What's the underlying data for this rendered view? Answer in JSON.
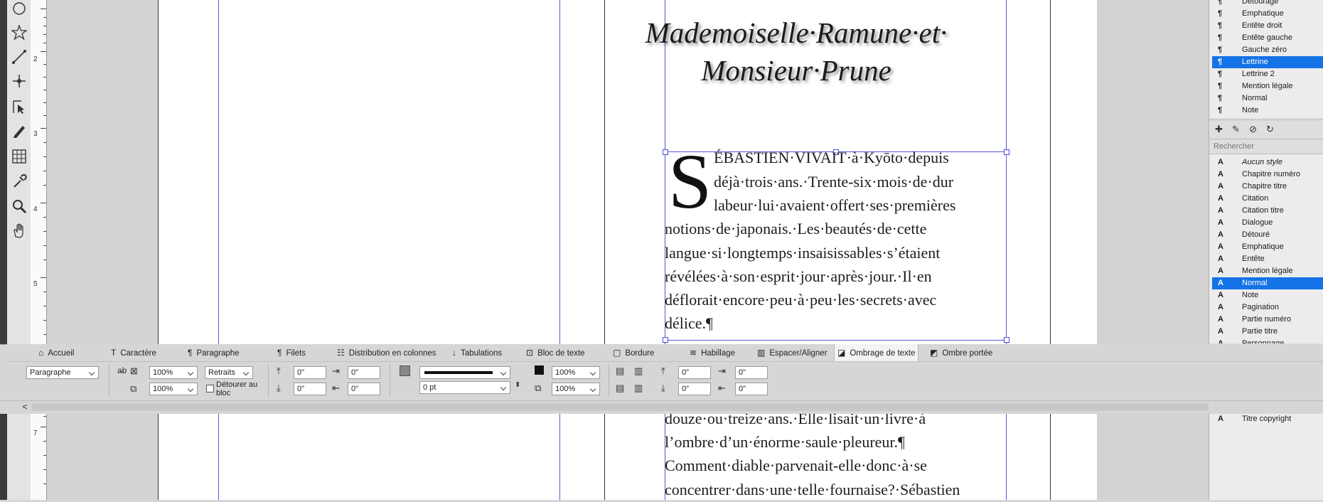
{
  "toolbox": {
    "tools": [
      "ellipse-tool-icon",
      "star-tool-icon",
      "line-tool-icon",
      "pen-anchor-tool-icon",
      "direct-selection-tool-icon",
      "pencil-tool-icon",
      "table-tool-icon",
      "eyedropper-tool-icon",
      "zoom-tool-icon",
      "hand-tool-icon"
    ]
  },
  "ruler": {
    "numbers": [
      "2",
      "3",
      "4",
      "5",
      "7"
    ]
  },
  "document": {
    "title_line1": "Mademoiselle·Ramune·et·",
    "title_line2": "Monsieur·Prune",
    "dropcap": "S",
    "lines": [
      "ÉBASTIEN·VIVAIT·à·Kyōto·depuis",
      "déjà·trois·ans.·Trente-six·mois·de·dur",
      "labeur·lui·avaient·offert·ses·premières",
      "notions·de·japonais.·Les·beautés·de·cette",
      "langue·si·longtemps·insaisissables·s’étaient",
      "révélées·à·son·esprit·jour·après·jour.·Il·en",
      "déflorait·encore·peu·à·peu·les·secrets·avec",
      "délice.¶"
    ],
    "lines_bottom": [
      "douze·ou·treize·ans.·Elle·lisait·un·livre·à",
      "l’ombre·d’un·énorme·saule·pleureur.¶",
      "Comment·diable·parvenait-elle·donc·à·se",
      "concentrer·dans·une·telle·fournaise?·Sébastien"
    ]
  },
  "paragraph_styles": {
    "items": [
      {
        "label": "Détourage",
        "selected": false
      },
      {
        "label": "Emphatique",
        "selected": false
      },
      {
        "label": "Entête droit",
        "selected": false
      },
      {
        "label": "Entête gauche",
        "selected": false
      },
      {
        "label": "Gauche zéro",
        "selected": false
      },
      {
        "label": "Lettrine",
        "selected": true
      },
      {
        "label": "Lettrine 2",
        "selected": false
      },
      {
        "label": "Mention légale",
        "selected": false
      },
      {
        "label": "Normal",
        "selected": false
      },
      {
        "label": "Note",
        "selected": false
      }
    ],
    "icon": "¶"
  },
  "char_styles": {
    "search_placeholder": "Rechercher",
    "icon": "A",
    "items": [
      {
        "label": "Aucun style",
        "selected": false,
        "italic": true
      },
      {
        "label": "Chapitre numéro",
        "selected": false
      },
      {
        "label": "Chapitre titre",
        "selected": false
      },
      {
        "label": "Citation",
        "selected": false
      },
      {
        "label": "Citation titre",
        "selected": false
      },
      {
        "label": "Dialogue",
        "selected": false
      },
      {
        "label": "Détouré",
        "selected": false
      },
      {
        "label": "Emphatique",
        "selected": false
      },
      {
        "label": "Entête",
        "selected": false
      },
      {
        "label": "Mention légale",
        "selected": false
      },
      {
        "label": "Normal",
        "selected": true
      },
      {
        "label": "Note",
        "selected": false
      },
      {
        "label": "Pagination",
        "selected": false
      },
      {
        "label": "Partie numéro",
        "selected": false
      },
      {
        "label": "Partie titre",
        "selected": false
      },
      {
        "label": "Personnage",
        "selected": false
      }
    ],
    "footer_item": "Titre copyright"
  },
  "tabs": [
    {
      "label": "Accueil",
      "icon": "⌂"
    },
    {
      "label": "Caractère",
      "icon": "T"
    },
    {
      "label": "Paragraphe",
      "icon": "¶"
    },
    {
      "label": "Filets",
      "icon": "¶"
    },
    {
      "label": "Distribution en colonnes",
      "icon": "☷"
    },
    {
      "label": "Tabulations",
      "icon": "↓"
    },
    {
      "label": "Bloc de texte",
      "icon": "⊡"
    },
    {
      "label": "Bordure",
      "icon": "▢"
    },
    {
      "label": "Habillage",
      "icon": "≋"
    },
    {
      "label": "Espacer/Aligner",
      "icon": "▥"
    },
    {
      "label": "Ombrage de texte",
      "icon": "◪",
      "active": true
    },
    {
      "label": "Ombre portée",
      "icon": "◩"
    }
  ],
  "controls": {
    "mode": "Paragraphe",
    "scale1": "100%",
    "scale2": "100%",
    "indent_mode": "Retraits",
    "clip_label": "Détourer au bloc",
    "v1": "0\"",
    "v2": "0\"",
    "v3": "0\"",
    "v4": "0\"",
    "stroke_weight": "0 pt",
    "tint1": "100%",
    "tint2": "100%",
    "v5": "0\"",
    "v6": "0\"",
    "v7": "0\"",
    "v8": "0\""
  },
  "colors": {
    "accent": "#1473e6",
    "guide": "#5656e0"
  }
}
